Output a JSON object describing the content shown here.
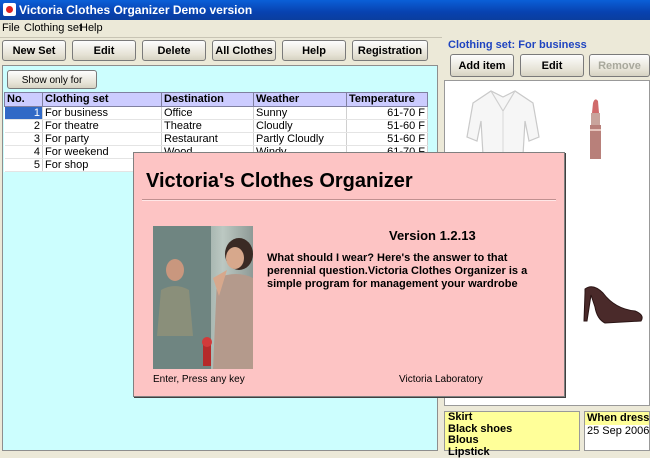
{
  "window": {
    "title": "Victoria Clothes Organizer Demo version"
  },
  "menu": {
    "file": "File",
    "clothing_set": "Clothing set",
    "help": "Help"
  },
  "toolbar": {
    "new_set": "New Set",
    "edit": "Edit",
    "delete": "Delete",
    "all_clothes": "All Clothes",
    "help": "Help",
    "registration": "Registration"
  },
  "filter": {
    "show_only_for": "Show only for"
  },
  "table": {
    "headers": {
      "no": "No.",
      "clothing_set": "Clothing set",
      "destination": "Destination",
      "weather": "Weather",
      "temperature": "Temperature"
    },
    "rows": [
      {
        "no": "1",
        "set": "For business",
        "destination": "Office",
        "weather": "Sunny",
        "temperature": "61-70 F"
      },
      {
        "no": "2",
        "set": "For theatre",
        "destination": "Theatre",
        "weather": "Cloudly",
        "temperature": "51-60 F"
      },
      {
        "no": "3",
        "set": "For party",
        "destination": "Restaurant",
        "weather": "Partly Cloudly",
        "temperature": "51-60 F"
      },
      {
        "no": "4",
        "set": "For weekend",
        "destination": "Wood",
        "weather": "Windy",
        "temperature": "61-70 F"
      },
      {
        "no": "5",
        "set": "For shop",
        "destination": "",
        "weather": "",
        "temperature": ""
      }
    ]
  },
  "right": {
    "set_title": "Clothing set: For business",
    "add_item": "Add item",
    "edit": "Edit",
    "remove": "Remove",
    "items": [
      "Skirt",
      "Black shoes",
      "Blous",
      "Lipstick"
    ],
    "when_dressed_header": "When dressed",
    "when_dressed_value": "25 Sep 2006"
  },
  "about": {
    "app_name": "Victoria's Clothes Organizer",
    "version": "Version 1.2.13",
    "description": "What should I wear? Here's the answer to that perennial question.Victoria Clothes Organizer is a simple program for management your wardrobe",
    "hint": "Enter,  Press any key",
    "company": "Victoria Laboratory"
  },
  "colors": {
    "titlebar": "#0842b0",
    "table_bg": "#ccfefe",
    "about_bg": "#fdc4c4",
    "selection": "#3169c6",
    "set_title": "#1f44c0"
  }
}
